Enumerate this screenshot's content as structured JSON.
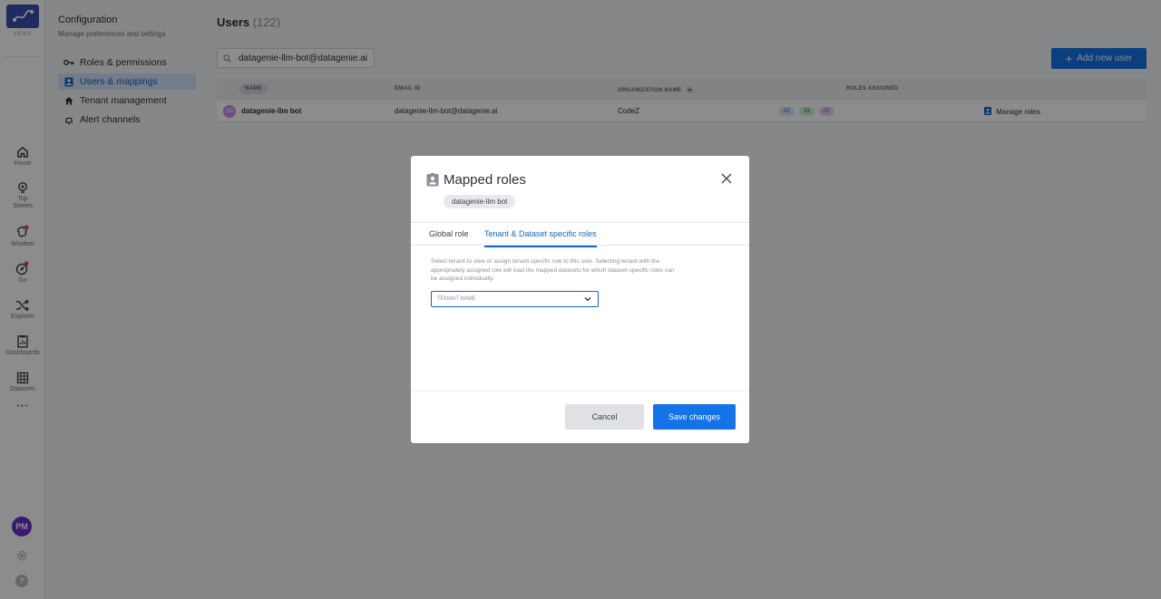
{
  "rail": {
    "logo_text": "VEXS",
    "nav": [
      {
        "label": "Home",
        "icon": "home-icon"
      },
      {
        "label": "Top Stories",
        "icon": "lightbulb-icon"
      },
      {
        "label": "Wisdom",
        "icon": "brain-icon"
      },
      {
        "label": "Go",
        "icon": "compass-icon"
      },
      {
        "label": "Explorer",
        "icon": "shuffle-icon"
      },
      {
        "label": "Dashboards",
        "icon": "clipboard-icon"
      },
      {
        "label": "Datasets",
        "icon": "grid-icon"
      }
    ],
    "more": "•••",
    "avatar": "PM",
    "help": "?"
  },
  "config": {
    "title": "Configuration",
    "subtitle": "Manage preferences and settings",
    "menu": [
      {
        "label": "Roles & permissions",
        "icon": "key-icon"
      },
      {
        "label": "Users & mappings",
        "icon": "user-badge-icon"
      },
      {
        "label": "Tenant management",
        "icon": "home-small-icon"
      },
      {
        "label": "Alert channels",
        "icon": "bell-icon"
      }
    ]
  },
  "users": {
    "title": "Users",
    "count": "(122)",
    "search_value": "datagenie-llm-bot@datagenie.ai",
    "add_button": "Add new user",
    "columns": {
      "name": "NAME",
      "email": "EMAIL ID",
      "org": "ORGANIZATION NAME",
      "roles": "ROLES ASSIGNED"
    },
    "rows": [
      {
        "initials": "DB",
        "name": "datagenie-llm bot",
        "email": "datagenie-llm-bot@datagenie.ai",
        "org": "CodeZ",
        "chips": [
          "01",
          "33",
          "03"
        ],
        "action": "Manage roles"
      }
    ]
  },
  "modal": {
    "title": "Mapped roles",
    "user_chip": "datagenie-llm bot",
    "tabs": [
      "Global role",
      "Tenant & Dataset specific roles"
    ],
    "help_text": "Select tenant to view or assign tenant-specific role to this user. Selecting tenant with the appropriately assigned role will load the mapped datasets for which dataset-specific roles can be assigned individually.",
    "tenant_placeholder": "TENANT NAME",
    "cancel": "Cancel",
    "save": "Save changes"
  },
  "colors": {
    "accent": "#1473e6",
    "active_menu": "#cfe2fb",
    "logo_bg": "#3b4fb0",
    "avatar_bg": "#6c2fd0"
  }
}
